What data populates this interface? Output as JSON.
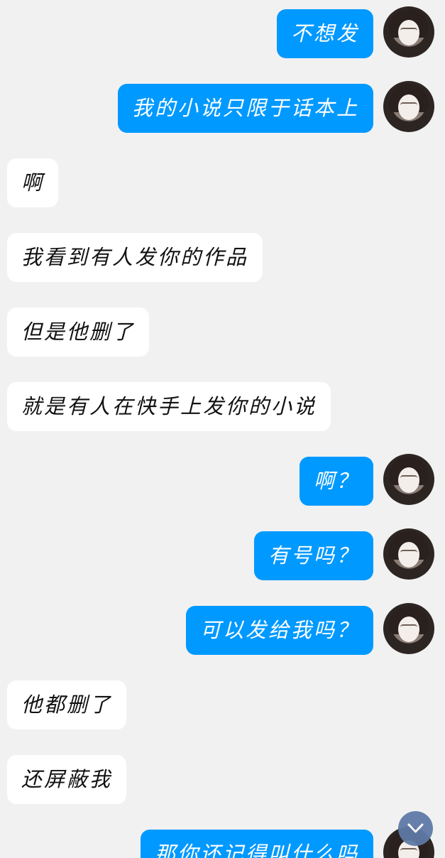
{
  "messages": [
    {
      "from": "me",
      "text": "不想发"
    },
    {
      "from": "me",
      "text": "我的小说只限于话本上"
    },
    {
      "from": "them",
      "text": "啊"
    },
    {
      "from": "them",
      "text": "我看到有人发你的作品"
    },
    {
      "from": "them",
      "text": "但是他删了"
    },
    {
      "from": "them",
      "text": "就是有人在快手上发你的小说"
    },
    {
      "from": "me",
      "text": "啊？"
    },
    {
      "from": "me",
      "text": "有号吗？"
    },
    {
      "from": "me",
      "text": "可以发给我吗？"
    },
    {
      "from": "them",
      "text": "他都删了"
    },
    {
      "from": "them",
      "text": "还屏蔽我"
    },
    {
      "from": "me",
      "text": "那你还记得叫什么吗"
    }
  ],
  "colors": {
    "me_bubble": "#0099ff",
    "them_bubble": "#ffffff",
    "background": "#f1f1f1"
  },
  "icons": {
    "scroll_down": "chevron-down-icon",
    "avatar": "user-avatar"
  }
}
